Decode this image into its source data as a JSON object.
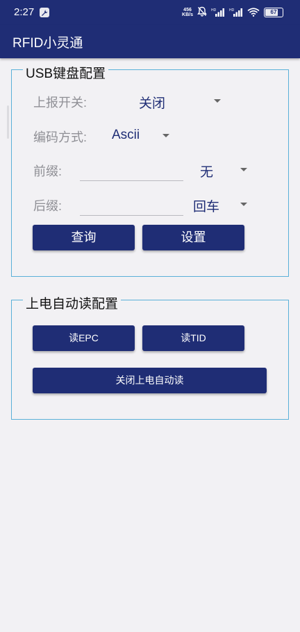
{
  "status_bar": {
    "time": "2:27",
    "network_speed_value": "456",
    "network_speed_unit": "KB/s",
    "battery_level": "67"
  },
  "app_bar": {
    "title": "RFID小灵通"
  },
  "usb_keyboard": {
    "title": "USB键盘配置",
    "report_switch_label": "上报开关:",
    "report_switch_value": "关闭",
    "encoding_label": "编码方式:",
    "encoding_value": "Ascii",
    "prefix_label": "前缀:",
    "prefix_value": "",
    "prefix_option": "无",
    "suffix_label": "后缀:",
    "suffix_value": "",
    "suffix_option": "回车",
    "query_button": "查询",
    "set_button": "设置"
  },
  "power_on_read": {
    "title": "上电自动读配置",
    "read_epc_button": "读EPC",
    "read_tid_button": "读TID",
    "disable_button": "关闭上电自动读"
  },
  "colors": {
    "primary": "#1f2d75",
    "accent_border": "#5ab0d8",
    "background": "#f2f1f4"
  }
}
